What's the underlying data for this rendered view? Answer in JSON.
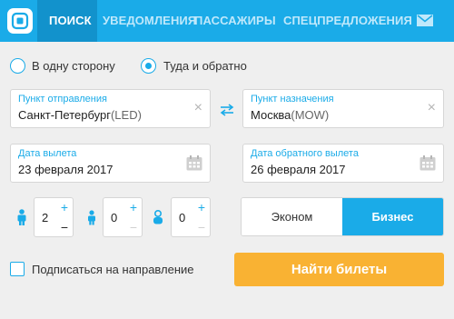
{
  "colors": {
    "accent": "#1aabe8",
    "accent_dark": "#1292cc",
    "search_button": "#f9b233"
  },
  "header": {
    "logo_icon": "app-logo-icon",
    "nav": [
      {
        "label": "ПОИСК",
        "active": true
      },
      {
        "label": "УВЕДОМЛЕНИЯ",
        "active": false
      },
      {
        "label": "ПАССАЖИРЫ",
        "active": false
      },
      {
        "label": "СПЕЦПРЕДЛОЖЕНИЯ",
        "active": false
      }
    ],
    "mail_icon": "mail-icon"
  },
  "trip_type": {
    "options": [
      {
        "label": "В одну сторону",
        "selected": false
      },
      {
        "label": "Туда и обратно",
        "selected": true
      }
    ]
  },
  "origin": {
    "label": "Пункт отправления",
    "city": "Санкт-Петербург",
    "code": "(LED)"
  },
  "destination": {
    "label": "Пункт назначения",
    "city": "Москва",
    "code": "(MOW)"
  },
  "departure_date": {
    "label": "Дата вылета",
    "value": "23 февраля 2017"
  },
  "return_date": {
    "label": "Дата обратного вылета",
    "value": "26 февраля 2017"
  },
  "passengers": {
    "adults": {
      "value": "2",
      "icon": "adult-icon"
    },
    "children": {
      "value": "0",
      "icon": "child-icon"
    },
    "infants": {
      "value": "0",
      "icon": "infant-icon"
    },
    "plus": "+",
    "minus": "−"
  },
  "cabin_class": {
    "options": [
      {
        "label": "Эконом",
        "selected": false
      },
      {
        "label": "Бизнес",
        "selected": true
      }
    ]
  },
  "subscribe": {
    "label": "Подписаться на направление",
    "checked": false
  },
  "search_button": {
    "label": "Найти билеты"
  },
  "icons": {
    "clear": "×"
  }
}
